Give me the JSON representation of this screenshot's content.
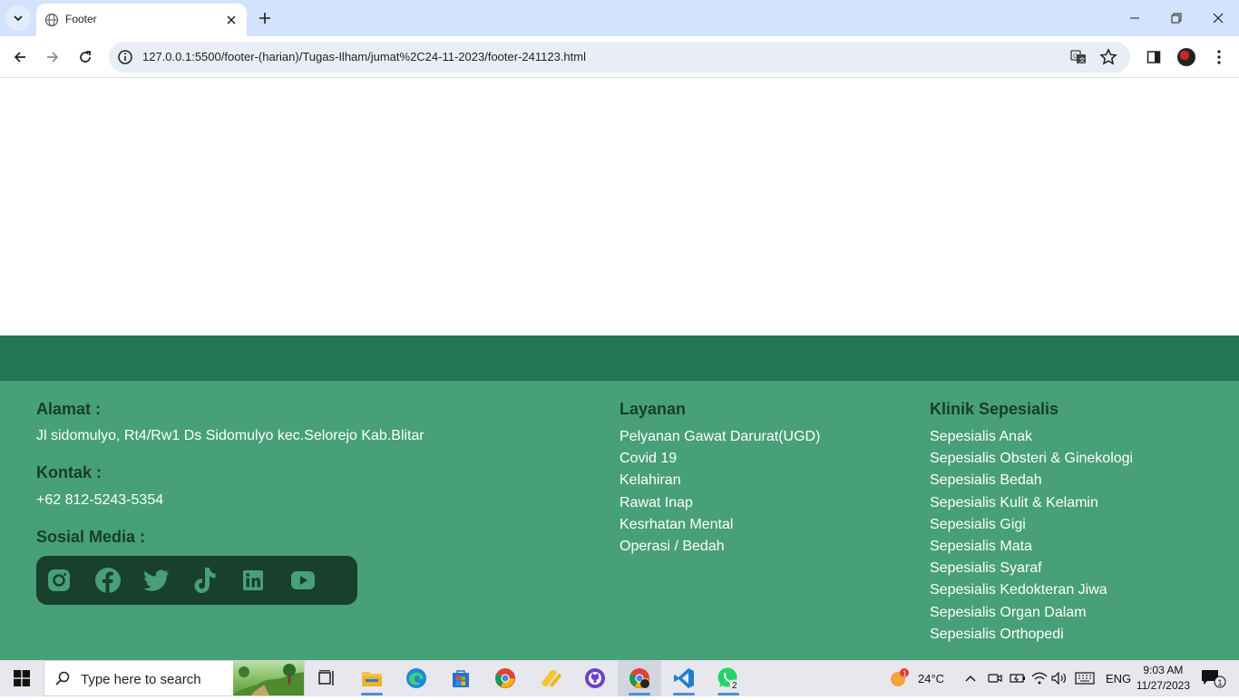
{
  "browser": {
    "tab_title": "Footer",
    "url": "127.0.0.1:5500/footer-(harian)/Tugas-Ilham/jumat%2C24-11-2023/footer-241123.html"
  },
  "footer": {
    "alamat": {
      "heading": "Alamat :",
      "text": "Jl sidomulyo, Rt4/Rw1 Ds Sidomulyo kec.Selorejo Kab.Blitar"
    },
    "kontak": {
      "heading": "Kontak :",
      "text": "+62 812-5243-5354"
    },
    "sosial": {
      "heading": "Sosial Media :",
      "icons": [
        "instagram-icon",
        "facebook-icon",
        "twitter-icon",
        "tiktok-icon",
        "linkedin-icon",
        "youtube-icon"
      ]
    },
    "layanan": {
      "heading": "Layanan",
      "items": [
        "Pelyanan Gawat Darurat(UGD)",
        "Covid 19",
        "Kelahiran",
        "Rawat Inap",
        "Kesrhatan Mental",
        "Operasi / Bedah"
      ]
    },
    "klinik": {
      "heading": "Klinik Sepesialis",
      "items": [
        "Sepesialis Anak",
        "Sepesialis Obsteri & Ginekologi",
        "Sepesialis Bedah",
        "Sepesialis Kulit & Kelamin",
        "Sepesialis Gigi",
        "Sepesialis Mata",
        "Sepesialis Syaraf",
        "Sepesialis Kedokteran Jiwa",
        "Sepesialis Organ Dalam",
        "Sepesialis Orthopedi"
      ]
    },
    "colors": {
      "band_dark": "#217756",
      "band_main": "#47a077",
      "heading": "#173e2b",
      "social_bg": "#193f2d"
    }
  },
  "taskbar": {
    "search_placeholder": "Type here to search",
    "weather_temp": "24°C",
    "weather_badge": "1",
    "language": "ENG",
    "time": "9:03 AM",
    "date": "11/27/2023",
    "whatsapp_badge": "2",
    "notification_badge": "1"
  }
}
